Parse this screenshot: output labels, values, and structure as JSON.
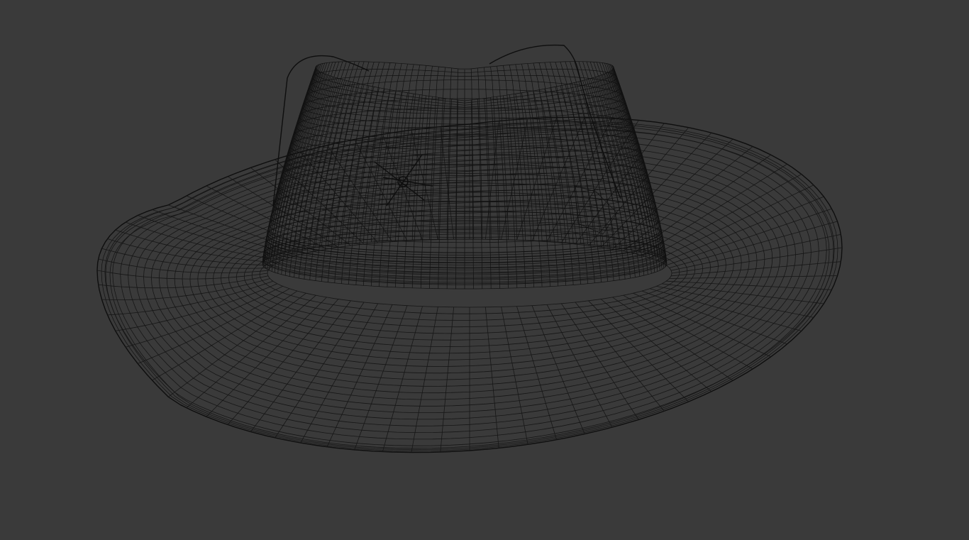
{
  "viewport": {
    "background_color": "#3a3a3a",
    "render_mode": "wireframe"
  },
  "model": {
    "object": "cowboy-hat-mesh",
    "wire_color": "#161616"
  }
}
